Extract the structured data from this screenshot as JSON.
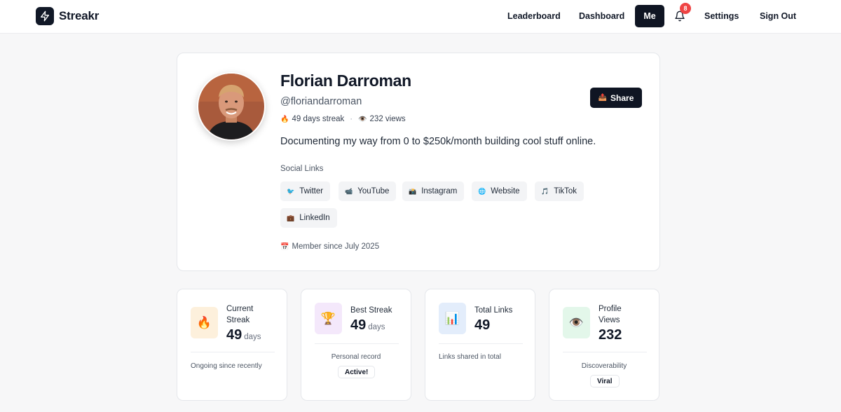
{
  "brand": {
    "name": "Streakr",
    "logo_icon": "lightning-bolt-icon"
  },
  "nav": {
    "leaderboard": "Leaderboard",
    "dashboard": "Dashboard",
    "me": "Me",
    "notifications_count": "8",
    "settings": "Settings",
    "sign_out": "Sign Out"
  },
  "profile": {
    "name": "Florian Darroman",
    "handle": "@floriandarroman",
    "streak_text": "49 days streak",
    "views_text": "232 views",
    "bio": "Documenting my way from 0 to $250k/month building cool stuff online.",
    "share_label": "Share",
    "social_title": "Social Links",
    "social_links": [
      {
        "icon": "🐦",
        "label": "Twitter"
      },
      {
        "icon": "📹",
        "label": "YouTube"
      },
      {
        "icon": "📸",
        "label": "Instagram"
      },
      {
        "icon": "🌐",
        "label": "Website"
      },
      {
        "icon": "🎵",
        "label": "TikTok"
      },
      {
        "icon": "💼",
        "label": "LinkedIn"
      }
    ],
    "member_since": "Member since July 2025"
  },
  "stats": [
    {
      "label": "Current Streak",
      "value": "49",
      "unit": "days",
      "note": "Ongoing since recently",
      "icon": "🔥",
      "icon_bg": "#fdf0dc"
    },
    {
      "label": "Best Streak",
      "value": "49",
      "unit": "days",
      "note": "Personal record",
      "badge": "Active!",
      "icon": "🏆",
      "icon_bg": "#f4e8fb"
    },
    {
      "label": "Total Links",
      "value": "49",
      "unit": "",
      "note": "Links shared in total",
      "icon": "📊",
      "icon_bg": "#e3edfb"
    },
    {
      "label": "Profile Views",
      "value": "232",
      "unit": "",
      "note": "Discoverability",
      "badge": "Viral",
      "icon": "👁️",
      "icon_bg": "#e3f7ea"
    }
  ],
  "colors": {
    "primary": "#0f1523",
    "badge": "#ef4444",
    "background": "#f7f7f8"
  }
}
